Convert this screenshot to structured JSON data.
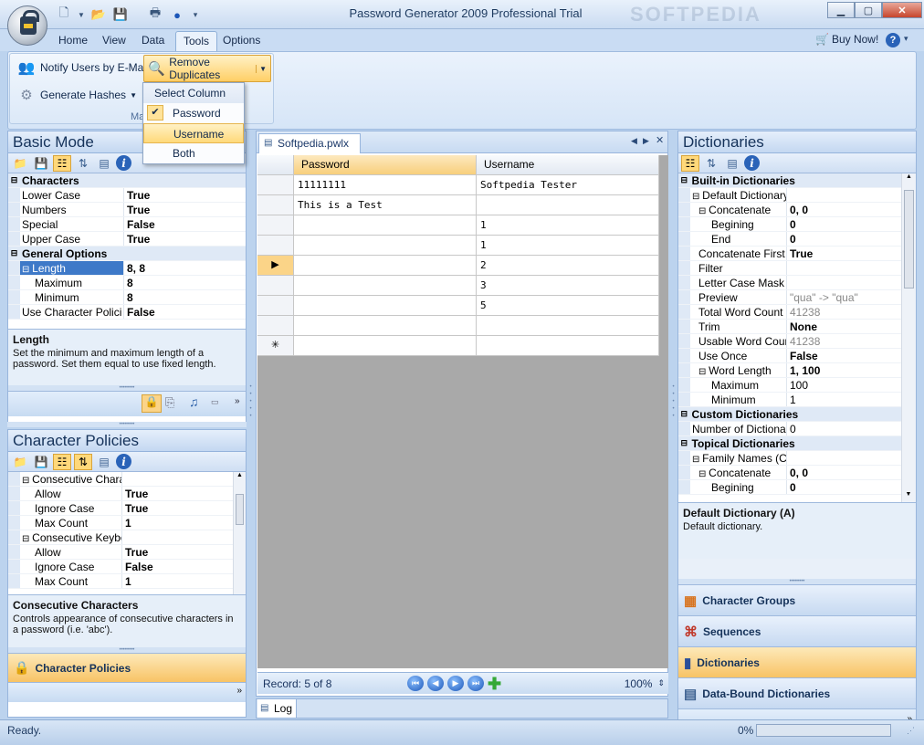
{
  "app": {
    "title": "Password Generator 2009 Professional Trial",
    "watermark": "SOFTPEDIA"
  },
  "menu_tabs": [
    {
      "label": "Home"
    },
    {
      "label": "View"
    },
    {
      "label": "Data"
    },
    {
      "label": "Tools",
      "active": true
    },
    {
      "label": "Options"
    }
  ],
  "help": {
    "buy_label": "Buy Now!"
  },
  "ribbon": {
    "notify_label": "Notify Users by E-Mail",
    "hashes_label": "Generate Hashes",
    "remove_dup_label": "Remove Duplicates",
    "group_label": "Ma"
  },
  "dropdown": {
    "header": "Select Column",
    "items": [
      {
        "label": "Password",
        "checked": true
      },
      {
        "label": "Username",
        "highlighted": true
      },
      {
        "label": "Both"
      }
    ]
  },
  "basic_mode": {
    "title": "Basic Mode",
    "rows": [
      {
        "type": "cat",
        "key": "Characters"
      },
      {
        "key": "Lower Case",
        "value": "True",
        "bold": true
      },
      {
        "key": "Numbers",
        "value": "True",
        "bold": true
      },
      {
        "key": "Special",
        "value": "False",
        "bold": true
      },
      {
        "key": "Upper Case",
        "value": "True",
        "bold": true
      },
      {
        "type": "cat",
        "key": "General Options"
      },
      {
        "key": "Length",
        "value": "8, 8",
        "bold": true,
        "selected": true,
        "expander": "−"
      },
      {
        "key": "Maximum",
        "value": "8",
        "bold": true,
        "indent": 2
      },
      {
        "key": "Minimum",
        "value": "8",
        "bold": true,
        "indent": 2
      },
      {
        "key": "Use Character Polici",
        "value": "False",
        "bold": true
      }
    ],
    "desc_title": "Length",
    "desc_text": "Set the minimum and maximum length of a password. Set them equal to use fixed length."
  },
  "char_policies": {
    "title": "Character Policies",
    "rows": [
      {
        "key": "Consecutive Charac",
        "value": "",
        "expander": "−"
      },
      {
        "key": "Allow",
        "value": "True",
        "bold": true,
        "indent": 2
      },
      {
        "key": "Ignore Case",
        "value": "True",
        "bold": true,
        "indent": 2
      },
      {
        "key": "Max Count",
        "value": "1",
        "bold": true,
        "indent": 2
      },
      {
        "key": "Consecutive Keyboa",
        "value": "",
        "expander": "−"
      },
      {
        "key": "Allow",
        "value": "True",
        "bold": true,
        "indent": 2
      },
      {
        "key": "Ignore Case",
        "value": "False",
        "bold": true,
        "indent": 2
      },
      {
        "key": "Max Count",
        "value": "1",
        "bold": true,
        "indent": 2
      }
    ],
    "desc_title": "Consecutive Characters",
    "desc_text": "Controls appearance of consecutive characters in a password (i.e. 'abc').",
    "bottom_button": "Character Policies"
  },
  "document": {
    "tab": "Softpedia.pwlx",
    "columns": [
      "Password",
      "Username"
    ],
    "rows": [
      {
        "password": "11111111",
        "username": "Softpedia Tester",
        "marker": ""
      },
      {
        "password": "This is a Test",
        "username": "",
        "marker": ""
      },
      {
        "password": "",
        "username": "1",
        "marker": ""
      },
      {
        "password": "",
        "username": "1",
        "marker": ""
      },
      {
        "password": "",
        "username": "2",
        "marker": "▶",
        "current": true
      },
      {
        "password": "",
        "username": "3",
        "marker": ""
      },
      {
        "password": "",
        "username": "5",
        "marker": ""
      },
      {
        "password": "",
        "username": "",
        "marker": ""
      },
      {
        "password": "",
        "username": "",
        "marker": "✳"
      }
    ],
    "record_label": "Record: 5 of 8",
    "zoom": "100%",
    "log_tab": "Log"
  },
  "dictionaries": {
    "title": "Dictionaries",
    "rows": [
      {
        "type": "cat",
        "key": "Built-in Dictionaries"
      },
      {
        "key": "Default Dictionary (A)",
        "value": "",
        "expander": "−"
      },
      {
        "key": "Concatenate",
        "value": "0, 0",
        "bold": true,
        "indent": 1,
        "expander": "−"
      },
      {
        "key": "Begining",
        "value": "0",
        "bold": true,
        "indent": 3
      },
      {
        "key": "End",
        "value": "0",
        "bold": true,
        "indent": 3
      },
      {
        "key": "Concatenate First",
        "value": "True",
        "bold": true,
        "indent": 1
      },
      {
        "key": "Filter",
        "value": "",
        "indent": 1
      },
      {
        "key": "Letter Case Mask",
        "value": "",
        "indent": 1
      },
      {
        "key": "Preview",
        "value": "\"qua\" -> \"qua\"",
        "gray": true,
        "indent": 1
      },
      {
        "key": "Total Word Count",
        "value": "41238",
        "gray": true,
        "indent": 1
      },
      {
        "key": "Trim",
        "value": "None",
        "bold": true,
        "indent": 1
      },
      {
        "key": "Usable Word Cour",
        "value": "41238",
        "gray": true,
        "indent": 1
      },
      {
        "key": "Use Once",
        "value": "False",
        "bold": true,
        "indent": 1
      },
      {
        "key": "Word Length",
        "value": "1, 100",
        "bold": true,
        "indent": 1,
        "expander": "−"
      },
      {
        "key": "Maximum",
        "value": "100",
        "indent": 3
      },
      {
        "key": "Minimum",
        "value": "1",
        "indent": 3
      },
      {
        "type": "cat",
        "key": "Custom Dictionaries"
      },
      {
        "key": "Number of Dictionarie",
        "value": "0"
      },
      {
        "type": "cat",
        "key": "Topical Dictionaries"
      },
      {
        "key": "Family Names (C)",
        "value": "",
        "expander": "−"
      },
      {
        "key": "Concatenate",
        "value": "0, 0",
        "bold": true,
        "indent": 1,
        "expander": "−"
      },
      {
        "key": "Begining",
        "value": "0",
        "bold": true,
        "indent": 3
      }
    ],
    "desc_title": "Default Dictionary (A)",
    "desc_text": "Default dictionary.",
    "nav": [
      {
        "label": "Character Groups",
        "icon": "character-groups-icon"
      },
      {
        "label": "Sequences",
        "icon": "sequences-icon"
      },
      {
        "label": "Dictionaries",
        "icon": "dictionaries-icon",
        "active": true
      },
      {
        "label": "Data-Bound Dictionaries",
        "icon": "data-bound-icon"
      }
    ]
  },
  "status": {
    "text": "Ready.",
    "progress": "0%"
  }
}
